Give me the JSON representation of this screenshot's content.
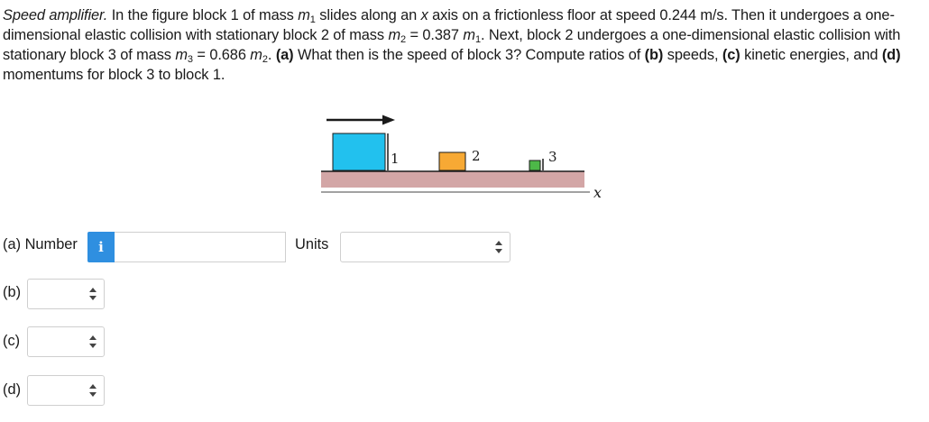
{
  "problem": {
    "title": "Speed amplifier.",
    "t1": " In the figure block 1 of mass ",
    "m1": "m",
    "s1": "1",
    "t2": " slides along an ",
    "xvar": "x",
    "t3": " axis on a frictionless floor at speed 0.244 m/s. Then it undergoes a one-dimensional elastic collision with stationary block 2 of mass ",
    "m2": "m",
    "s2": "2",
    "t4": " = 0.387 ",
    "m2b": "m",
    "s2b": "1",
    "t5": ". Next, block 2 undergoes a one-dimensional elastic collision with stationary block 3 of mass ",
    "m3": "m",
    "s3": "3",
    "t6": " = 0.686 ",
    "m3b": "m",
    "s3b": "2",
    "t7": ". ",
    "pa": "(a)",
    "qa": " What then is the speed of block 3? Compute ratios of ",
    "pb": "(b)",
    "qb": " speeds, ",
    "pc": "(c)",
    "qc": " kinetic energies, and ",
    "pd": "(d)",
    "qd": " momentums for block 3 to block 1."
  },
  "figure": {
    "block1_label": "1",
    "block2_label": "2",
    "block3_label": "3",
    "axis_label": "x",
    "colors": {
      "block1": "#22c1ee",
      "block2": "#f7a934",
      "block3": "#4db848",
      "floor": "#d3a6a6",
      "arrow": "#1a1a1a"
    }
  },
  "answers": {
    "a_label": "(a) Number",
    "info_icon": "i",
    "number_value": "",
    "units_label": "Units",
    "units_selected": "",
    "b_label": "(b)",
    "b_selected": "",
    "c_label": "(c)",
    "c_selected": "",
    "d_label": "(d)",
    "d_selected": ""
  }
}
